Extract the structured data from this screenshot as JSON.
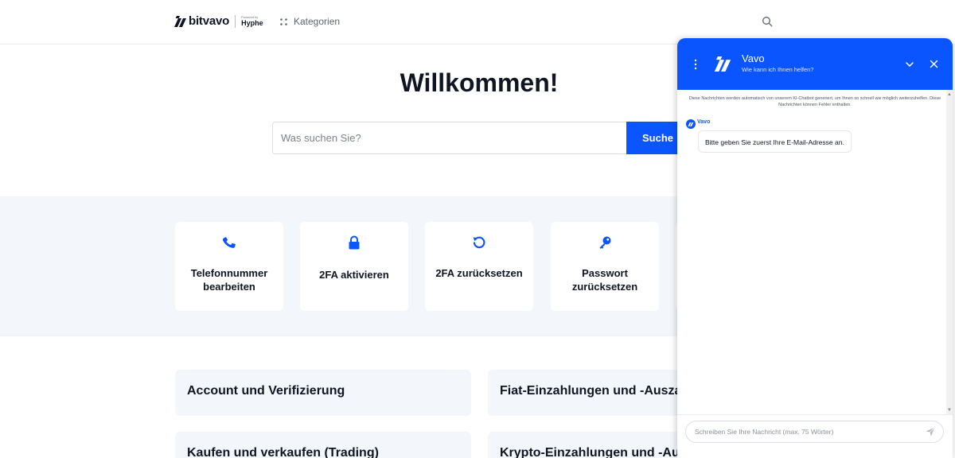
{
  "header": {
    "logo_text": "bitvavo",
    "powered_small": "Powered by",
    "powered_name": "Hyphe",
    "categories_label": "Kategorien"
  },
  "hero": {
    "title": "Willkommen!",
    "search_placeholder": "Was suchen Sie?",
    "search_button": "Suche"
  },
  "quick_actions": [
    {
      "label": "Telefonnummer bearbeiten",
      "icon": "phone-icon"
    },
    {
      "label": "2FA aktivieren",
      "icon": "lock-icon"
    },
    {
      "label": "2FA zurücksetzen",
      "icon": "reset-icon"
    },
    {
      "label": "Passwort zurücksetzen",
      "icon": "key-icon"
    }
  ],
  "categories": [
    "Account und Verifizierung",
    "Fiat-Einzahlungen und -Auszahlungen",
    "Kaufen und verkaufen (Trading)",
    "Krypto-Einzahlungen und -Auszahlungen"
  ],
  "chat": {
    "name": "Vavo",
    "subtitle": "Wie kann ich Ihnen helfen?",
    "notice": "Diese Nachrichten werden automatisch von unserem KI-Chatbot generiert, um Ihnen so schnell wie möglich weiterzuhelfen. Diese Nachrichten können Fehler enthalten.",
    "bot_name": "Vavo",
    "message": "Bitte geben Sie zuerst Ihre E-Mail-Adresse an.",
    "input_placeholder": "Schreiben Sie Ihre Nachricht (max. 75 Wörter)"
  },
  "colors": {
    "brand_blue": "#0b55ff",
    "band_background": "#f3f7fb",
    "text_dark": "#0f1522"
  }
}
